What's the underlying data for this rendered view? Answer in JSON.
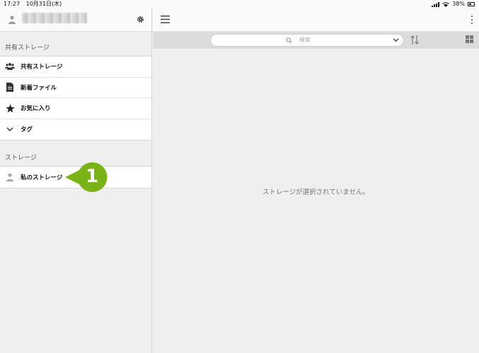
{
  "status": {
    "time": "17:27",
    "date": "10月31日(木)",
    "battery": "38%"
  },
  "sidebar": {
    "shared_section_label": "共有ストレージ",
    "shared_items": [
      {
        "label": "共有ストレージ",
        "icon": "users-icon"
      },
      {
        "label": "新着ファイル",
        "icon": "new-file-icon"
      },
      {
        "label": "お気に入り",
        "icon": "star-icon"
      },
      {
        "label": "タグ",
        "icon": "chevron-down-icon"
      }
    ],
    "storage_section_label": "ストレージ",
    "storage_items": [
      {
        "label": "私のストレージ",
        "icon": "user-icon"
      }
    ]
  },
  "callout": {
    "number": "1",
    "color": "#7ab317"
  },
  "search": {
    "placeholder": "検索"
  },
  "main": {
    "empty_message": "ストレージが選択されていません。"
  }
}
